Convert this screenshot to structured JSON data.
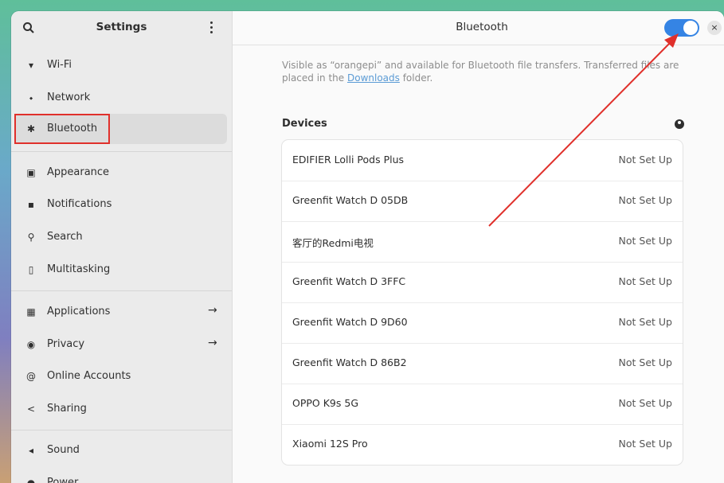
{
  "sidebar": {
    "title": "Settings",
    "items": [
      {
        "label": "Wi-Fi",
        "icon": "wifi-icon",
        "glyph": "▾"
      },
      {
        "label": "Network",
        "icon": "network-icon",
        "glyph": "⬩"
      },
      {
        "label": "Bluetooth",
        "icon": "bluetooth-icon",
        "glyph": "✱"
      },
      {
        "label": "Appearance",
        "icon": "appearance-icon",
        "glyph": "▣"
      },
      {
        "label": "Notifications",
        "icon": "notifications-icon",
        "glyph": "▪"
      },
      {
        "label": "Search",
        "icon": "search-icon",
        "glyph": "⚲"
      },
      {
        "label": "Multitasking",
        "icon": "multitasking-icon",
        "glyph": "▯"
      },
      {
        "label": "Applications",
        "icon": "applications-icon",
        "glyph": "▦"
      },
      {
        "label": "Privacy",
        "icon": "privacy-icon",
        "glyph": "◉"
      },
      {
        "label": "Online Accounts",
        "icon": "online-accounts-icon",
        "glyph": "@"
      },
      {
        "label": "Sharing",
        "icon": "sharing-icon",
        "glyph": "<"
      },
      {
        "label": "Sound",
        "icon": "sound-icon",
        "glyph": "◂"
      },
      {
        "label": "Power",
        "icon": "power-icon",
        "glyph": "●"
      }
    ],
    "arrow": "→"
  },
  "main": {
    "title": "Bluetooth",
    "close": "×",
    "bluetooth_enabled": true,
    "desc_before": "Visible as “orangepi” and available for Bluetooth file transfers. Transferred files are placed in the ",
    "desc_link": "Downloads",
    "desc_after": " folder.",
    "devices_title": "Devices",
    "devices": [
      {
        "name": "EDIFIER Lolli Pods Plus",
        "status": "Not Set Up"
      },
      {
        "name": "Greenfit Watch D 05DB",
        "status": "Not Set Up"
      },
      {
        "name": "客厅的Redmi电视",
        "status": "Not Set Up"
      },
      {
        "name": "Greenfit Watch D 3FFC",
        "status": "Not Set Up"
      },
      {
        "name": "Greenfit Watch D 9D60",
        "status": "Not Set Up"
      },
      {
        "name": "Greenfit Watch D 86B2",
        "status": "Not Set Up"
      },
      {
        "name": "OPPO K9s 5G",
        "status": "Not Set Up"
      },
      {
        "name": "Xiaomi 12S Pro",
        "status": "Not Set Up"
      }
    ]
  },
  "colors": {
    "accent": "#3584e4",
    "annotation": "#e0302b"
  }
}
